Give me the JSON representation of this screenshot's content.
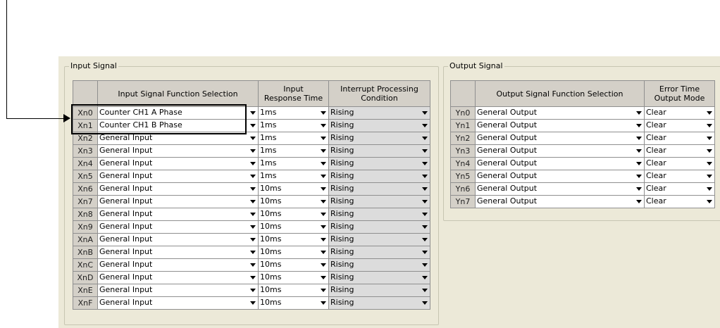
{
  "input_group": {
    "title": "Input Signal",
    "headers": {
      "function": "Input Signal Function Selection",
      "response_l1": "Input",
      "response_l2": "Response Time",
      "interrupt_l1": "Interrupt Processing",
      "interrupt_l2": "Condition"
    },
    "rows": [
      {
        "id": "Xn0",
        "func": "Counter CH1 A Phase",
        "resp": "1ms",
        "intr": "Rising"
      },
      {
        "id": "Xn1",
        "func": "Counter CH1 B Phase",
        "resp": "1ms",
        "intr": "Rising"
      },
      {
        "id": "Xn2",
        "func": "General Input",
        "resp": "1ms",
        "intr": "Rising"
      },
      {
        "id": "Xn3",
        "func": "General Input",
        "resp": "1ms",
        "intr": "Rising"
      },
      {
        "id": "Xn4",
        "func": "General Input",
        "resp": "1ms",
        "intr": "Rising"
      },
      {
        "id": "Xn5",
        "func": "General Input",
        "resp": "1ms",
        "intr": "Rising"
      },
      {
        "id": "Xn6",
        "func": "General Input",
        "resp": "10ms",
        "intr": "Rising"
      },
      {
        "id": "Xn7",
        "func": "General Input",
        "resp": "10ms",
        "intr": "Rising"
      },
      {
        "id": "Xn8",
        "func": "General Input",
        "resp": "10ms",
        "intr": "Rising"
      },
      {
        "id": "Xn9",
        "func": "General Input",
        "resp": "10ms",
        "intr": "Rising"
      },
      {
        "id": "XnA",
        "func": "General Input",
        "resp": "10ms",
        "intr": "Rising"
      },
      {
        "id": "XnB",
        "func": "General Input",
        "resp": "10ms",
        "intr": "Rising"
      },
      {
        "id": "XnC",
        "func": "General Input",
        "resp": "10ms",
        "intr": "Rising"
      },
      {
        "id": "XnD",
        "func": "General Input",
        "resp": "10ms",
        "intr": "Rising"
      },
      {
        "id": "XnE",
        "func": "General Input",
        "resp": "10ms",
        "intr": "Rising"
      },
      {
        "id": "XnF",
        "func": "General Input",
        "resp": "10ms",
        "intr": "Rising"
      }
    ]
  },
  "output_group": {
    "title": "Output Signal",
    "headers": {
      "function": "Output Signal Function Selection",
      "error_l1": "Error Time",
      "error_l2": "Output Mode"
    },
    "rows": [
      {
        "id": "Yn0",
        "func": "General Output",
        "mode": "Clear"
      },
      {
        "id": "Yn1",
        "func": "General Output",
        "mode": "Clear"
      },
      {
        "id": "Yn2",
        "func": "General Output",
        "mode": "Clear"
      },
      {
        "id": "Yn3",
        "func": "General Output",
        "mode": "Clear"
      },
      {
        "id": "Yn4",
        "func": "General Output",
        "mode": "Clear"
      },
      {
        "id": "Yn5",
        "func": "General Output",
        "mode": "Clear"
      },
      {
        "id": "Yn6",
        "func": "General Output",
        "mode": "Clear"
      },
      {
        "id": "Yn7",
        "func": "General Output",
        "mode": "Clear"
      }
    ]
  },
  "colors": {
    "panel": "#ece9d8",
    "header": "#d4d0c8",
    "greyed_cell": "#dcdcdc"
  }
}
